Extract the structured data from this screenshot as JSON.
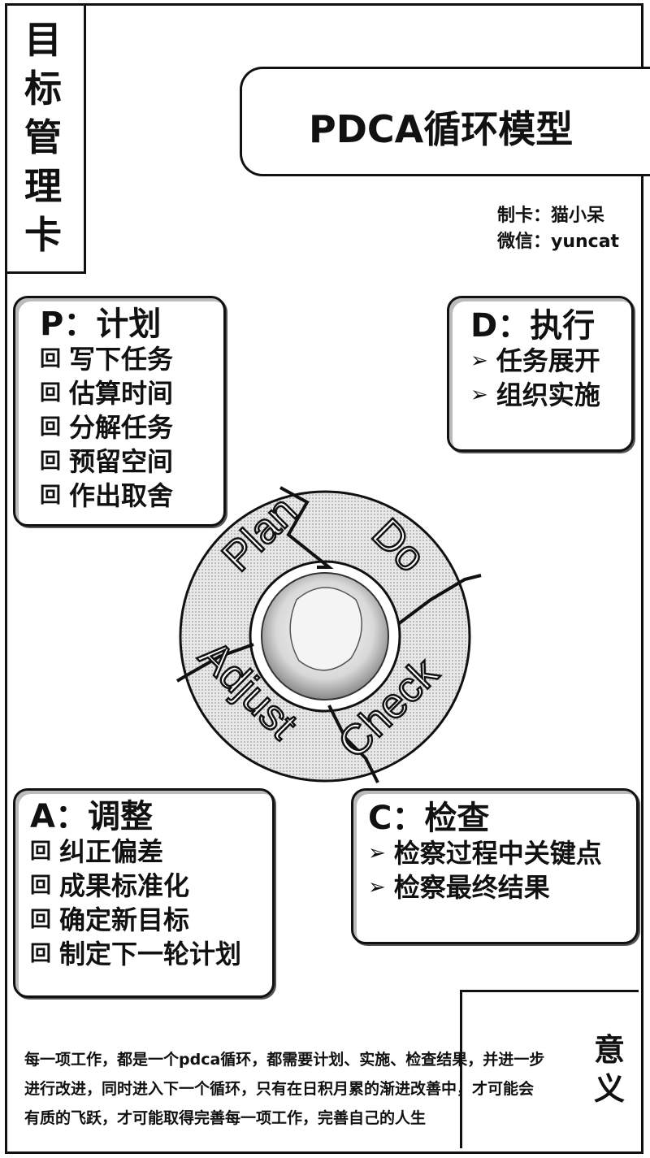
{
  "side_title": [
    "目",
    "标",
    "管",
    "理",
    "卡"
  ],
  "title": "PDCA循环模型",
  "credits": {
    "author": "制卡：猫小呆",
    "wechat": "微信：yuncat"
  },
  "plan": {
    "heading": "P：计划",
    "mark": "回",
    "items": [
      "写下任务",
      "估算时间",
      "分解任务",
      "预留空间",
      "作出取舍"
    ]
  },
  "do": {
    "heading": "D：执行",
    "mark": "➢",
    "items": [
      "任务展开",
      "组织实施"
    ]
  },
  "adjust": {
    "heading": "A：调整",
    "mark": "回",
    "items": [
      "纠正偏差",
      "成果标准化",
      "确定新目标",
      "制定下一轮计划"
    ]
  },
  "check": {
    "heading": "C：检查",
    "mark": "➢",
    "items": [
      "检察过程中关键点",
      "检察最终结果"
    ]
  },
  "cycle": {
    "labels": [
      "Plan",
      "Do",
      "Check",
      "Adjust"
    ]
  },
  "meaning": {
    "heading": [
      "意",
      "义"
    ],
    "lines": [
      "每一项工作，都是一个pdca循环，都需要计划、实施、检查结果，并进一步",
      "进行改进，同时进入下一个循环，只有在日积月累的渐进改善中，才可能会",
      "有质的飞跃，才可能取得完善每一项工作，完善自己的人生"
    ]
  }
}
